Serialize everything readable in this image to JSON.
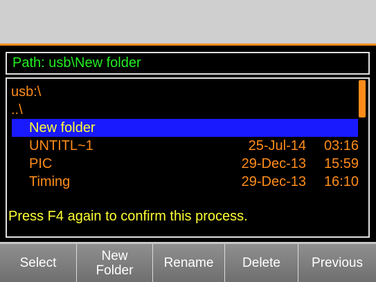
{
  "path": {
    "label": "Path: usb\\New folder"
  },
  "list": {
    "root": "usb:\\",
    "parent": "..\\",
    "selected": "New folder",
    "files": [
      {
        "name": "UNTITL~1",
        "date": "25-Jul-14",
        "time": "03:16"
      },
      {
        "name": "PIC",
        "date": "29-Dec-13",
        "time": "15:59"
      },
      {
        "name": "Timing",
        "date": "29-Dec-13",
        "time": "16:10"
      }
    ],
    "scroll_position": 0
  },
  "status": "Press F4 again to confirm this process.",
  "softkeys": {
    "select": "Select",
    "new_folder_line1": "New",
    "new_folder_line2": "Folder",
    "rename": "Rename",
    "delete": "Delete",
    "previous": "Previous"
  },
  "colors": {
    "path_text": "#22ee22",
    "file_text": "#ff8c1a",
    "selection_bg": "#1a1aff",
    "selection_text": "#ffff33",
    "status_text": "#ffff33"
  }
}
